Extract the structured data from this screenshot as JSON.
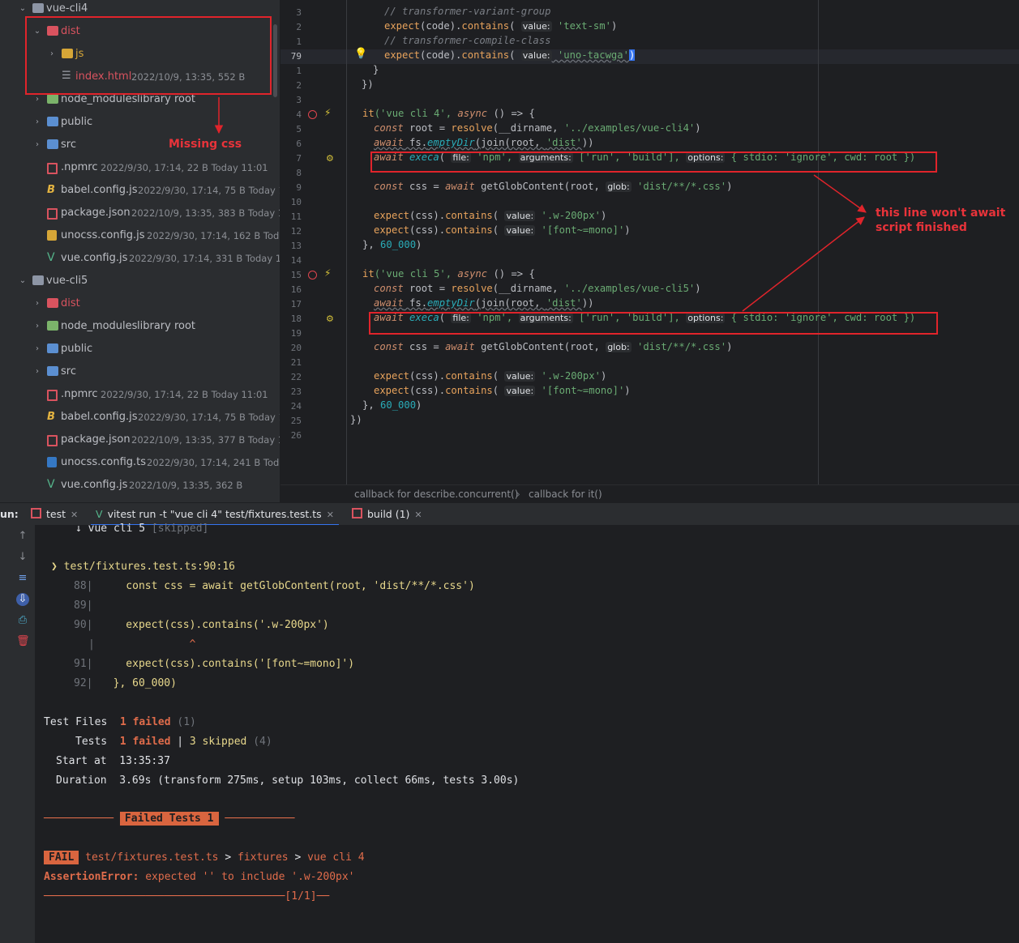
{
  "tree": {
    "items": [
      {
        "label": "vue-cli4",
        "meta": "",
        "kind": "folder"
      },
      {
        "label": "dist",
        "meta": "",
        "kind": "folder-red"
      },
      {
        "label": "js",
        "meta": "",
        "kind": "folder-yellow"
      },
      {
        "label": "index.html",
        "meta": "2022/10/9, 13:35, 552 B",
        "kind": "file-html"
      },
      {
        "label": "node_modules",
        "meta": "library root",
        "kind": "folder-green"
      },
      {
        "label": "public",
        "meta": "",
        "kind": "folder-blue"
      },
      {
        "label": "src",
        "meta": "",
        "kind": "folder-blue"
      },
      {
        "label": ".npmrc",
        "meta": "2022/9/30, 17:14, 22 B Today 11:01",
        "kind": "file-npm"
      },
      {
        "label": "babel.config.js",
        "meta": "2022/9/30, 17:14, 75 B Today 11:0",
        "kind": "file-babel"
      },
      {
        "label": "package.json",
        "meta": "2022/10/9, 13:35, 383 B Today 11:5",
        "kind": "file-npm"
      },
      {
        "label": "unocss.config.js",
        "meta": "2022/9/30, 17:14, 162 B Today 1",
        "kind": "file-js"
      },
      {
        "label": "vue.config.js",
        "meta": "2022/9/30, 17:14, 331 B Today 11:47",
        "kind": "file-vue"
      },
      {
        "label": "vue-cli5",
        "meta": "",
        "kind": "folder"
      },
      {
        "label": "dist",
        "meta": "",
        "kind": "folder-red"
      },
      {
        "label": "node_modules",
        "meta": "library root",
        "kind": "folder-green"
      },
      {
        "label": "public",
        "meta": "",
        "kind": "folder-blue"
      },
      {
        "label": "src",
        "meta": "",
        "kind": "folder-blue"
      },
      {
        "label": ".npmrc",
        "meta": "2022/9/30, 17:14, 22 B Today 11:01",
        "kind": "file-npm"
      },
      {
        "label": "babel.config.js",
        "meta": "2022/9/30, 17:14, 75 B Today 11:0",
        "kind": "file-babel"
      },
      {
        "label": "package.json",
        "meta": "2022/10/9, 13:35, 377 B Today 11:0",
        "kind": "file-npm"
      },
      {
        "label": "unocss.config.ts",
        "meta": "2022/9/30, 17:14, 241 B Today 1",
        "kind": "file-ts"
      },
      {
        "label": "vue.config.js",
        "meta": "2022/10/9, 13:35, 362 B",
        "kind": "file-vue"
      }
    ]
  },
  "editor": {
    "line_numbers": [
      "3",
      "2",
      "1",
      "79",
      "1",
      "2",
      "3",
      "4",
      "5",
      "6",
      "7",
      "8",
      "9",
      "10",
      "11",
      "12",
      "13",
      "14",
      "15",
      "16",
      "17",
      "18",
      "19",
      "20",
      "21",
      "22",
      "23",
      "24",
      "25",
      "26"
    ],
    "current_line": "79",
    "lines": {
      "l0_cmt": "// transformer-variant-group",
      "l1_a": "expect",
      "l1_b": "(code).",
      "l1_c": "contains",
      "l1_d": "( ",
      "l1_hint": "value:",
      "l1_e": " 'text-sm'",
      "l1_f": ")",
      "l2_cmt": "// transformer-compile-class",
      "l3_a": "expect",
      "l3_b": "(code).",
      "l3_c": "contains",
      "l3_d": "( ",
      "l3_hint": "value:",
      "l3_e": " 'uno-tacwga'",
      "l3_f": ")",
      "l4": "}",
      "l5": "})",
      "l7_a": "it",
      "l7_b": "('vue cli 4', ",
      "l7_c": "async",
      "l7_d": " () => {",
      "l8_a": "const",
      "l8_b": " root = ",
      "l8_c": "resolve",
      "l8_d": "(__dirname, ",
      "l8_e": "'../examples/vue-cli4'",
      "l8_f": ")",
      "l9_a": "await",
      "l9_b": " fs.",
      "l9_c": "emptyDir",
      "l9_d": "(join(root, ",
      "l9_e": "'dist'",
      "l9_f": "))",
      "l10_a": "await",
      "l10_b": " execa",
      "l10_c": "( ",
      "l10_h1": "file:",
      "l10_d": " 'npm', ",
      "l10_h2": "arguments:",
      "l10_e": " ['run', 'build'], ",
      "l10_h3": "options:",
      "l10_f": " { stdio: 'ignore', cwd: root })",
      "l12_a": "const",
      "l12_b": " css = ",
      "l12_c": "await",
      "l12_d": " getGlobContent(root, ",
      "l12_h": "glob:",
      "l12_e": " 'dist/**/*.css'",
      "l12_f": ")",
      "l14_a": "expect",
      "l14_b": "(css).",
      "l14_c": "contains",
      "l14_d": "( ",
      "l14_h": "value:",
      "l14_e": " '.w-200px'",
      "l14_f": ")",
      "l15_a": "expect",
      "l15_b": "(css).",
      "l15_c": "contains",
      "l15_d": "( ",
      "l15_h": "value:",
      "l15_e": " '[font~=mono]'",
      "l15_f": ")",
      "l16_a": "}, ",
      "l16_b": "60_000",
      "l16_c": ")",
      "l18_a": "it",
      "l18_b": "('vue cli 5', ",
      "l18_c": "async",
      "l18_d": " () => {",
      "l19_e": "'../examples/vue-cli5'",
      "l27": "})"
    },
    "breadcrumb": [
      "callback for describe.concurrent()",
      "callback for it()"
    ]
  },
  "run": {
    "label": "un:",
    "tabs": [
      {
        "label": "test"
      },
      {
        "label": "vitest run -t \"vue cli 4\" test/fixtures.test.ts"
      },
      {
        "label": "build (1)"
      }
    ],
    "console": {
      "skipped_line": "↓ vue cli 5",
      "skipped_tag": "[skipped]",
      "location": "❯ test/fixtures.test.ts:90:16",
      "code": [
        {
          "num": "88|",
          "text": "    const css = await getGlobContent(root, 'dist/**/*.css')"
        },
        {
          "num": "89|",
          "text": ""
        },
        {
          "num": "90|",
          "text": "    expect(css).contains('.w-200px')"
        },
        {
          "num": "|",
          "text": "              ^"
        },
        {
          "num": "91|",
          "text": "    expect(css).contains('[font~=mono]')"
        },
        {
          "num": "92|",
          "text": "  }, 60_000)"
        }
      ],
      "test_files_label": "Test Files",
      "test_files_failed": "1 failed",
      "test_files_total": "(1)",
      "tests_label": "Tests",
      "tests_failed": "1 failed",
      "tests_sep": " | ",
      "tests_skipped": "3 skipped",
      "tests_total": "(4)",
      "start_label": "Start at",
      "start_value": "13:35:37",
      "duration_label": "Duration",
      "duration_value": "3.69s (transform 275ms, setup 103ms, collect 66ms, tests 3.00s)",
      "failed_tests_banner": "Failed Tests 1",
      "fail_badge": "FAIL",
      "fail_path": "test/fixtures.test.ts",
      "fail_sep": " > ",
      "fail_suite": "fixtures",
      "fail_test": "vue cli 4",
      "assertion_label": "AssertionError:",
      "assertion_msg": " expected '' to include '.w-200px'",
      "page_counter": "[1/1]"
    }
  },
  "annotations": {
    "missing_css": "Missing css",
    "wont_await_line1": "this line won't await",
    "wont_await_line2": "script finished"
  }
}
